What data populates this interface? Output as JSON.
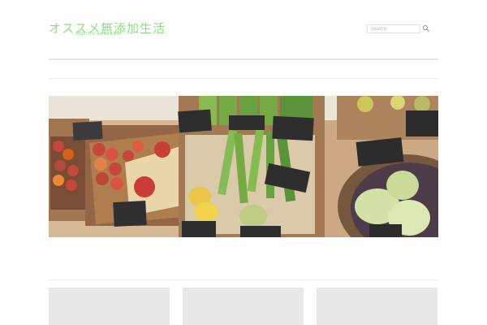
{
  "header": {
    "site_title": "オススメ無添加生活",
    "site_url": "http://mu-tenka.com",
    "search_placeholder": "Search"
  },
  "colors": {
    "brand": "#8ae27b",
    "divider": "#e6e6e6",
    "tile": "#e8e8e8"
  },
  "hero": {
    "description_icon": "vegetable-market-photo"
  },
  "tiles": [
    {
      "icon": "post-thumbnail"
    },
    {
      "icon": "post-thumbnail"
    },
    {
      "icon": "post-thumbnail"
    }
  ]
}
